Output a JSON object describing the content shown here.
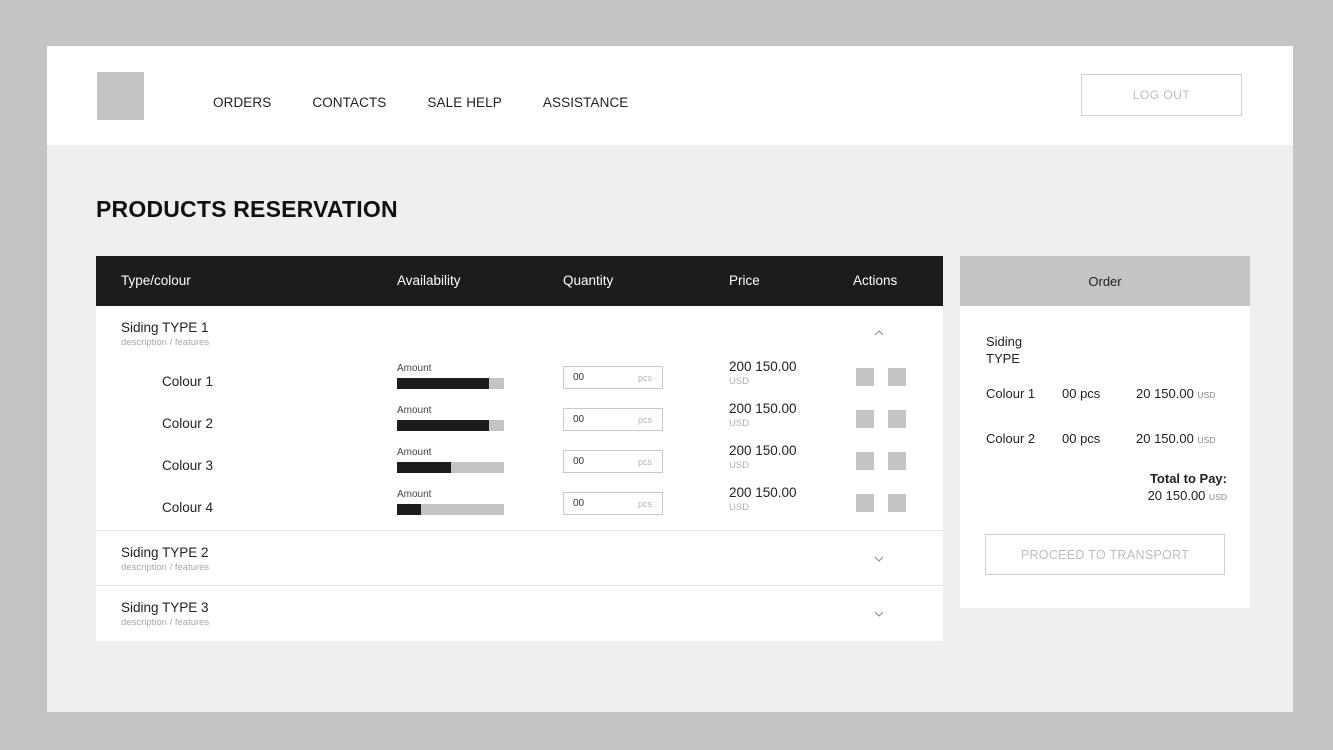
{
  "nav": {
    "items": [
      "ORDERS",
      "CONTACTS",
      "SALE HELP",
      "ASSISTANCE"
    ],
    "logout": "LOG OUT"
  },
  "page": {
    "title": "PRODUCTS RESERVATION"
  },
  "table": {
    "headers": {
      "type": "Type/colour",
      "availability": "Availability",
      "quantity": "Quantity",
      "price": "Price",
      "actions": "Actions"
    },
    "groups": [
      {
        "title": "Siding TYPE 1",
        "desc": "description / features",
        "expanded": true,
        "rows": [
          {
            "name": "Colour 1",
            "amount_label": "Amount",
            "availability": 0.86,
            "qty": "00",
            "unit": "pcs",
            "price": "200 150.00",
            "currency": "USD"
          },
          {
            "name": "Colour 2",
            "amount_label": "Amount",
            "availability": 0.86,
            "qty": "00",
            "unit": "pcs",
            "price": "200 150.00",
            "currency": "USD"
          },
          {
            "name": "Colour 3",
            "amount_label": "Amount",
            "availability": 0.5,
            "qty": "00",
            "unit": "pcs",
            "price": "200 150.00",
            "currency": "USD"
          },
          {
            "name": "Colour 4",
            "amount_label": "Amount",
            "availability": 0.22,
            "qty": "00",
            "unit": "pcs",
            "price": "200 150.00",
            "currency": "USD"
          }
        ]
      },
      {
        "title": "Siding TYPE 2",
        "desc": "description / features",
        "expanded": false
      },
      {
        "title": "Siding TYPE 3",
        "desc": "description / features",
        "expanded": false
      }
    ]
  },
  "order": {
    "header": "Order",
    "type_label": "Siding TYPE",
    "rows": [
      {
        "colour": "Colour 1",
        "pcs": "00 pcs",
        "amount": "20 150.00",
        "currency": "USD"
      },
      {
        "colour": "Colour 2",
        "pcs": "00 pcs",
        "amount": "20 150.00",
        "currency": "USD"
      }
    ],
    "total_label": "Total to Pay:",
    "total_value": "20 150.00",
    "total_currency": "USD",
    "proceed": "PROCEED TO TRANSPORT"
  },
  "colors": {
    "header_dark": "#1c1c1c",
    "placeholder_gray": "#c4c4c4",
    "page_bg": "#efefef",
    "muted_text": "#b0b0b0"
  }
}
